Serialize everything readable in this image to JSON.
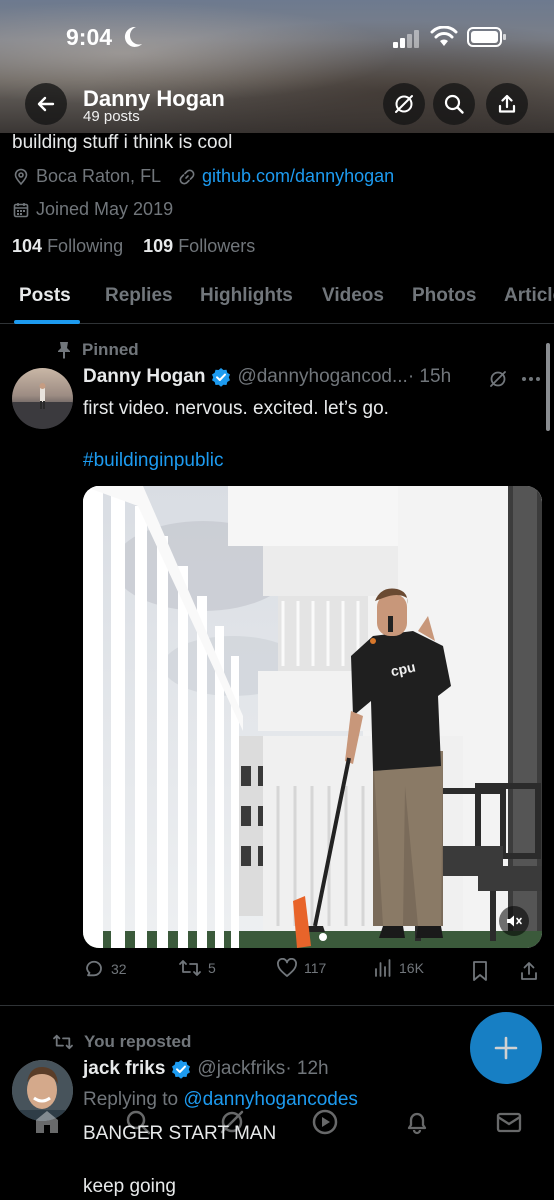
{
  "status_bar": {
    "time": "9:04"
  },
  "header": {
    "name": "Danny Hogan",
    "posts_count": "49 posts"
  },
  "profile": {
    "bio": "building stuff i think is cool",
    "location": "Boca Raton, FL",
    "website": "github.com/dannyhogan",
    "joined": "Joined May 2019",
    "following_count": "104",
    "following_label": "Following",
    "followers_count": "109",
    "followers_label": "Followers"
  },
  "tabs": [
    {
      "label": "Posts",
      "active": true
    },
    {
      "label": "Replies"
    },
    {
      "label": "Highlights"
    },
    {
      "label": "Videos"
    },
    {
      "label": "Photos"
    },
    {
      "label": "Articles"
    }
  ],
  "pinned_post": {
    "pinned_label": "Pinned",
    "author": "Danny Hogan",
    "handle": "@dannyhogancod...",
    "time": "· 15h",
    "text": "first video. nervous. excited. let’s go.",
    "hashtag": "#buildinginpublic",
    "shirt_text": "cpu",
    "replies": "32",
    "reposts": "5",
    "likes": "117",
    "views": "16K"
  },
  "repost": {
    "repost_label": "You reposted",
    "author": "jack friks",
    "handle": "@jackfriks",
    "time": "· 12h",
    "replying_prefix": "Replying to",
    "replying_to": "@dannyhogancodes",
    "text_line1": "BANGER START MAN",
    "text_line2": "keep going"
  },
  "colors": {
    "accent": "#1d9bf0",
    "muted": "#71767b",
    "text": "#e7e9ea",
    "background": "#000000"
  }
}
